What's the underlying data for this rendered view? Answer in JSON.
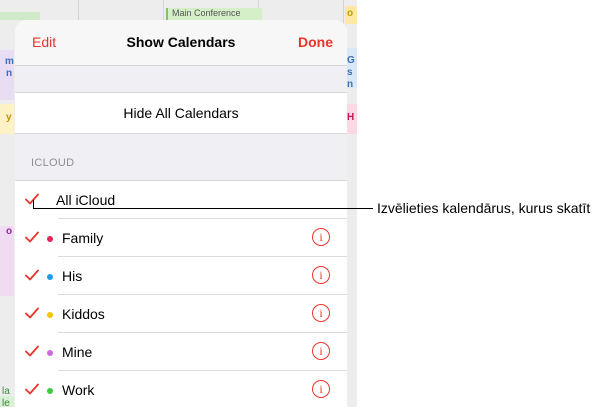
{
  "nav": {
    "edit_label": "Edit",
    "title": "Show Calendars",
    "done_label": "Done"
  },
  "hide_all_label": "Hide All Calendars",
  "section_header": "ICLOUD",
  "all_icloud": {
    "label": "All iCloud",
    "checked": true
  },
  "calendars": [
    {
      "name": "Family",
      "color": "#e8215b",
      "checked": true
    },
    {
      "name": "His",
      "color": "#1e9be8",
      "checked": true
    },
    {
      "name": "Kiddos",
      "color": "#f5c400",
      "checked": true
    },
    {
      "name": "Mine",
      "color": "#c86dd7",
      "checked": true
    },
    {
      "name": "Work",
      "color": "#3fca3f",
      "checked": true
    }
  ],
  "info_glyph": "i",
  "callout": "Izvēlieties kalendārus, kurus skatīt",
  "background": {
    "event_label": "Main Conference",
    "letters": [
      "m",
      "n",
      "G",
      "s",
      "n",
      "H",
      "o",
      "y",
      "o",
      "la",
      "le"
    ]
  },
  "accent_color": "#e8352b"
}
